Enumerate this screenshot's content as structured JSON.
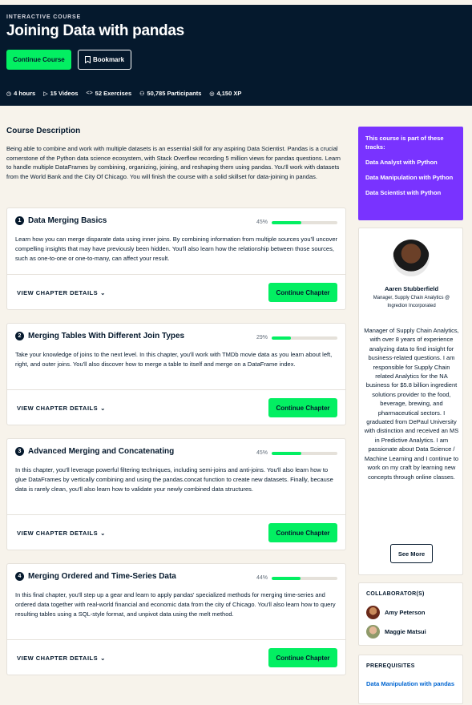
{
  "header": {
    "eyebrow": "INTERACTIVE COURSE",
    "title": "Joining Data with pandas",
    "continue_label": "Continue Course",
    "bookmark_label": "Bookmark",
    "stats": [
      {
        "icon": "clock-icon",
        "text": "4 hours"
      },
      {
        "icon": "play-icon",
        "text": "15 Videos"
      },
      {
        "icon": "code-icon",
        "text": "52 Exercises"
      },
      {
        "icon": "participants-icon",
        "text": "50,785 Participants"
      },
      {
        "icon": "xp-icon",
        "text": "4,150 XP"
      }
    ]
  },
  "description": {
    "title": "Course Description",
    "text": "Being able to combine and work with multiple datasets is an essential skill for any aspiring Data Scientist. Pandas is a crucial cornerstone of the Python data science ecosystem, with Stack Overflow recording 5 million views for pandas questions. Learn to handle multiple DataFrames by combining, organizing, joining, and reshaping them using pandas. You'll work with datasets from the World Bank and the City Of Chicago. You will finish the course with a solid skillset for data-joining in pandas."
  },
  "chapters": [
    {
      "number": "1",
      "title": "Data Merging Basics",
      "progress": 45,
      "progress_label": "45%",
      "description": "Learn how you can merge disparate data using inner joins. By combining information from multiple sources you'll uncover compelling insights that may have previously been hidden. You'll also learn how the relationship between those sources, such as one-to-one or one-to-many, can affect your result.",
      "details_label": "VIEW CHAPTER DETAILS",
      "button_label": "Continue Chapter"
    },
    {
      "number": "2",
      "title": "Merging Tables With Different Join Types",
      "progress": 29,
      "progress_label": "29%",
      "description": "Take your knowledge of joins to the next level. In this chapter, you'll work with TMDb movie data as you learn about left, right, and outer joins. You'll also discover how to merge a table to itself and merge on a DataFrame index.",
      "details_label": "VIEW CHAPTER DETAILS",
      "button_label": "Continue Chapter"
    },
    {
      "number": "3",
      "title": "Advanced Merging and Concatenating",
      "progress": 45,
      "progress_label": "45%",
      "description": "In this chapter, you'll leverage powerful filtering techniques, including semi-joins and anti-joins. You'll also learn how to glue DataFrames by vertically combining and using the pandas.concat function to create new datasets. Finally, because data is rarely clean, you'll also learn how to validate your newly combined data structures.",
      "details_label": "VIEW CHAPTER DETAILS",
      "button_label": "Continue Chapter"
    },
    {
      "number": "4",
      "title": "Merging Ordered and Time-Series Data",
      "progress": 44,
      "progress_label": "44%",
      "description": "In this final chapter, you'll step up a gear and learn to apply pandas' specialized methods for merging time-series and ordered data together with real-world financial and economic data from the city of Chicago. You'll also learn how to query resulting tables using a SQL-style format, and unpivot data using the melt method.",
      "details_label": "VIEW CHAPTER DETAILS",
      "button_label": "Continue Chapter"
    }
  ],
  "tracks": {
    "heading": "This course is part of these tracks:",
    "items": [
      "Data Analyst with Python",
      "Data Manipulation with Python",
      "Data Scientist with Python"
    ]
  },
  "instructor": {
    "name": "Aaren Stubberfield",
    "role": "Manager, Supply Chain Analytics @ Ingredion Incorporated",
    "bio": "Manager of Supply Chain Analytics, with over 8 years of experience analyzing data to find insight for business-related questions. I am responsible for Supply Chain related Analytics for the NA business for $5.8 billion ingredient solutions provider to the food, beverage, brewing, and pharmaceutical sectors. I graduated from DePaul University with distinction and received an MS in Predictive Analytics. I am passionate about Data Science / Machine Learning and I continue to work on my craft by learning new concepts through online classes.",
    "see_more_label": "See More"
  },
  "collaborators": {
    "heading": "COLLABORATOR(S)",
    "items": [
      "Amy Peterson",
      "Maggie Matsui"
    ]
  },
  "prerequisites": {
    "heading": "PREREQUISITES",
    "link": "Data Manipulation with pandas"
  },
  "colors": {
    "navy": "#05192d",
    "green": "#03ef62",
    "purple": "#7933ff",
    "link_blue": "#0065d1",
    "background": "#f7f3eb"
  }
}
